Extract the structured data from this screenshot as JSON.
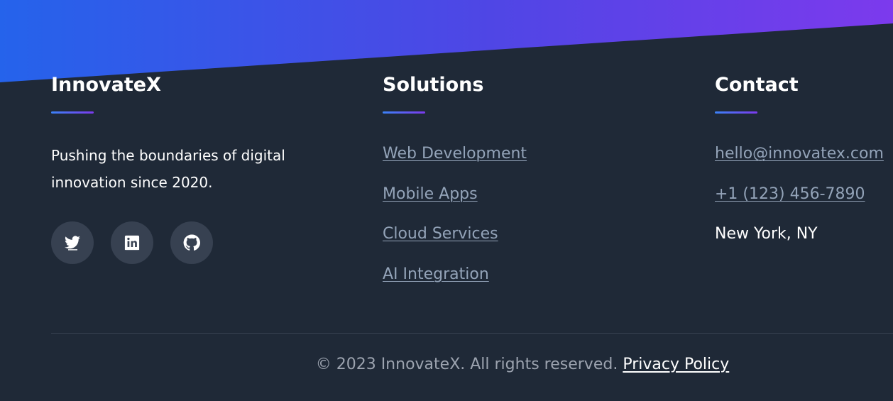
{
  "brand": {
    "name": "InnovateX",
    "description": "Pushing the boundaries of digital innovation since 2020.",
    "social": [
      {
        "name": "twitter-icon"
      },
      {
        "name": "linkedin-icon"
      },
      {
        "name": "github-icon"
      }
    ]
  },
  "solutions": {
    "title": "Solutions",
    "links": [
      "Web Development",
      "Mobile Apps",
      "Cloud Services",
      "AI Integration"
    ]
  },
  "contact": {
    "title": "Contact",
    "email": "hello@innovatex.com",
    "phone": "+1 (123) 456-7890",
    "location": "New York, NY"
  },
  "bottom": {
    "copyright": "© 2023 InnovateX. All rights reserved.",
    "privacy_label": "Privacy Policy"
  },
  "colors": {
    "background": "#1f2937",
    "gradient_start": "#2563eb",
    "gradient_end": "#7c3aed",
    "link": "#93a3b8",
    "icon_bg": "#374151"
  }
}
